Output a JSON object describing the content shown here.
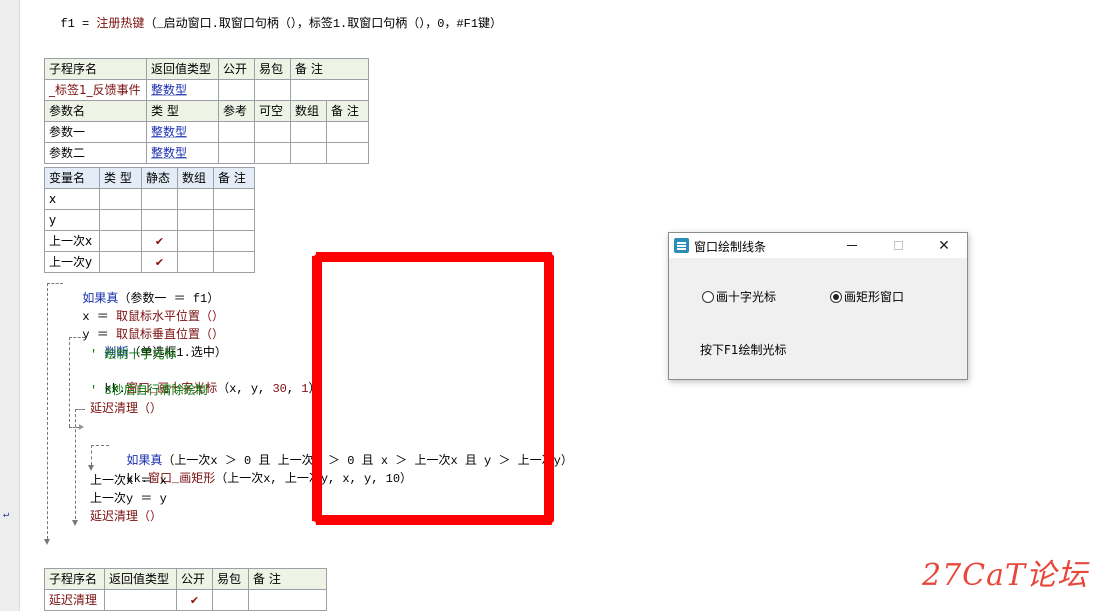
{
  "top_line": {
    "var": "f1",
    "eq": " = ",
    "fn": "注册热键",
    "args": "（_启动窗口.取窗口句柄（），标签1.取窗口句柄（），0，#F1键）"
  },
  "sub_table": {
    "headers": [
      "子程序名",
      "返回值类型",
      "公开",
      "易包",
      "备 注"
    ],
    "row": [
      "_标签1_反馈事件",
      "整数型",
      "",
      "",
      ""
    ],
    "param_headers": [
      "参数名",
      "类 型",
      "参考",
      "可空",
      "数组",
      "备 注"
    ],
    "params": [
      [
        "参数一",
        "整数型"
      ],
      [
        "参数二",
        "整数型"
      ]
    ]
  },
  "var_table": {
    "headers": [
      "变量名",
      "类 型",
      "静态",
      "数组",
      "备 注"
    ],
    "rows": [
      {
        "name": "x",
        "type": "",
        "static": ""
      },
      {
        "name": "y",
        "type": "",
        "static": ""
      },
      {
        "name": "上一次x",
        "type": "",
        "static": "✔"
      },
      {
        "name": "上一次y",
        "type": "",
        "static": "✔"
      }
    ]
  },
  "code": {
    "if1_kw": "如果真",
    "if1_cond": "（参数一 ＝ f1）",
    "x_assign": "x ＝ ",
    "x_fn": "取鼠标水平位置（）",
    "y_assign": "y ＝ ",
    "y_fn": "取鼠标垂直位置（）",
    "judge_kw": "判断",
    "judge_cond": "（单选框1.选中）",
    "comment1": "' 绘制十字光标",
    "kk_cross_obj": "kk.",
    "kk_cross_fn": "窗口_画十字光标",
    "kk_cross_args_a": "（x, y, ",
    "kk_cross_n1": "30",
    "kk_cross_sep": ", ",
    "kk_cross_n2": "1",
    "kk_cross_args_b": "）",
    "comment2": "' 3秒后自行清除绘制",
    "delay1": "延迟清理（）",
    "if2_kw": "如果真",
    "if2_cond": "（上一次x ＞ 0 且 上一次y ＞ 0 且 x ＞ 上一次x 且 y ＞ 上一次y）",
    "kk_rect_obj": "kk.",
    "kk_rect_fn": "窗口_画矩形",
    "kk_rect_args": "（上一次x, 上一次y, x, y, 10）",
    "lastx": "上一次x ＝ x",
    "lasty": "上一次y ＝ y",
    "delay2": "延迟清理（）"
  },
  "sub_table2": {
    "headers": [
      "子程序名",
      "返回值类型",
      "公开",
      "易包",
      "备 注"
    ],
    "row": [
      "延迟清理",
      "",
      "✔",
      "",
      ""
    ]
  },
  "gutter_marker": "↵",
  "dialog": {
    "title": "窗口绘制线条",
    "minimize": "—",
    "close": "✕",
    "radio1": "画十字光标",
    "radio2": "画矩形窗口",
    "selected": "画矩形窗口",
    "hint": "按下F1绘制光标"
  },
  "watermark": "27CaT论坛",
  "colors": {
    "red_rect": "#ff0000",
    "keyword": "#1a2fb0",
    "comment": "#0a7a0a",
    "function": "#7a1010"
  }
}
